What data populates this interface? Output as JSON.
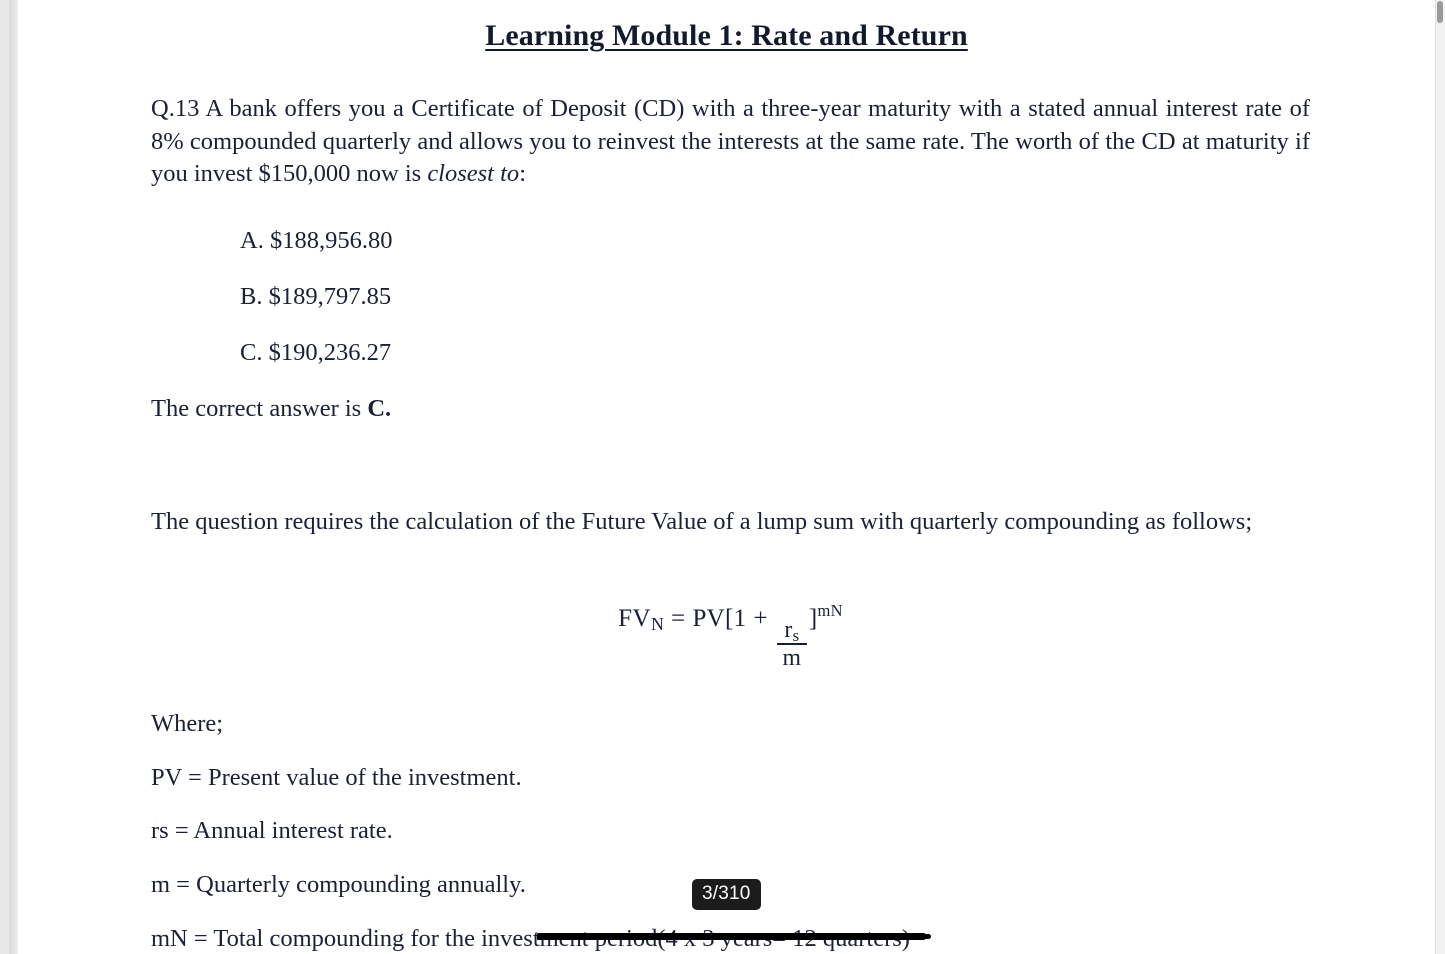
{
  "document": {
    "title": "Learning Module 1: Rate and Return",
    "question": {
      "number_and_text_part1": "Q.13 A bank offers you a Certificate of Deposit (CD) with a three-year maturity with a stated annual interest rate of 8% compounded quarterly and allows you to reinvest the interests at the same rate. The worth of the CD at maturity if you invest $150,000 now is ",
      "emphasis": "closest to",
      "text_part2": ":"
    },
    "options": [
      "A. $188,956.80",
      "B. $189,797.85",
      "C. $190,236.27"
    ],
    "answer": {
      "lead": "The correct answer is ",
      "choice": "C."
    },
    "explanation": "The question requires the calculation of the Future Value of a lump sum with quarterly compounding as follows;",
    "formula": {
      "lhs_base": "FV",
      "lhs_sub": "N",
      "equals": "=",
      "rhs_pv": "PV",
      "bracket_open": "[",
      "one": "1",
      "plus": "+",
      "frac_num_base": "r",
      "frac_num_sub": "s",
      "frac_den": "m",
      "bracket_close": "]",
      "exponent": "mN"
    },
    "where_heading": "Where;",
    "definitions": [
      "PV = Present value of the investment.",
      "rs = Annual interest rate.",
      "m = Quarterly compounding annually.",
      "mN = Total compounding for the investment period(4 x 3 years= 12 quarters)"
    ]
  },
  "viewer": {
    "page_indicator": "3/310"
  },
  "colors": {
    "text": "#1b2134",
    "badge_background": "#1c1c1c",
    "badge_text": "#ffffff",
    "page_background": "#ffffff"
  }
}
